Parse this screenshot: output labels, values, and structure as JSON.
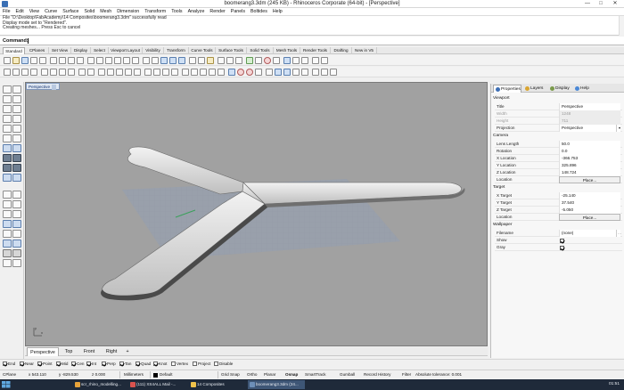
{
  "window": {
    "title": "boomerang3.3dm (245 KB) - Rhinoceros Corporate (64-bit) - [Perspective]",
    "minimize_glyph": "—",
    "maximize_glyph": "□",
    "close_glyph": "✕"
  },
  "menu": [
    "File",
    "Edit",
    "View",
    "Curve",
    "Surface",
    "Solid",
    "Mesh",
    "Dimension",
    "Transform",
    "Tools",
    "Analyze",
    "Render",
    "Panels",
    "Boltides",
    "Help"
  ],
  "history": [
    "File \"D:\\Desktop\\FabAcademy\\14 Composites\\boomerang3.3dm\" successfully read",
    "Display mode set to \"Rendered\".",
    "Creating meshes... Press Esc to cancel"
  ],
  "command": {
    "label": "Command:"
  },
  "toolbar_tabs": [
    "Standard",
    "CPlanes",
    "Set View",
    "Display",
    "Select",
    "Viewport Layout",
    "Visibility",
    "Transform",
    "Curve Tools",
    "Surface Tools",
    "Solid Tools",
    "Mesh Tools",
    "Render Tools",
    "Drafting",
    "New in V5"
  ],
  "viewport": {
    "name": "Perspective",
    "axis_x": "x",
    "axis_y": "y"
  },
  "viewport_tabs": [
    "Perspective",
    "Top",
    "Front",
    "Right",
    "+"
  ],
  "osnaps": [
    {
      "label": "End",
      "on": true
    },
    {
      "label": "Near",
      "on": true
    },
    {
      "label": "Point",
      "on": true
    },
    {
      "label": "Mid",
      "on": true
    },
    {
      "label": "Cen",
      "on": true
    },
    {
      "label": "Int",
      "on": true
    },
    {
      "label": "Perp",
      "on": true
    },
    {
      "label": "Tan",
      "on": true
    },
    {
      "label": "Quad",
      "on": true
    },
    {
      "label": "Knot",
      "on": true
    },
    {
      "label": "Vertex",
      "on": false
    },
    {
      "label": "Project",
      "on": false
    },
    {
      "label": "Disable",
      "on": false
    }
  ],
  "status": {
    "cplane": "CPlane",
    "x": "x 543.110",
    "y": "y -829.530",
    "z": "z 0.000",
    "units": "Millimeters",
    "layer": "Default",
    "layer_color": "#000000",
    "toggles": [
      "Grid Snap",
      "Ortho",
      "Planar",
      "Osnap",
      "SmartTrack",
      "Gumball",
      "Record History",
      "Filter"
    ],
    "tolerance": "Absolute tolerance: 0.001"
  },
  "panel": {
    "tabs": [
      "Properties",
      "Layers",
      "Display",
      "Help"
    ],
    "viewport_section": "Viewport",
    "viewport_rows": [
      {
        "k": "Title",
        "v": "Perspective",
        "dim": false
      },
      {
        "k": "Width",
        "v": "1248",
        "dim": true
      },
      {
        "k": "Height",
        "v": "711",
        "dim": true
      },
      {
        "k": "Projection",
        "v": "Perspective",
        "dim": false,
        "dropdown": true
      }
    ],
    "camera_section": "Camera",
    "camera_rows": [
      {
        "k": "Lens Length",
        "v": "50.0"
      },
      {
        "k": "Rotation",
        "v": "0.0"
      },
      {
        "k": "X Location",
        "v": "-366.753"
      },
      {
        "k": "Y Location",
        "v": "325.896"
      },
      {
        "k": "Z Location",
        "v": "148.724"
      },
      {
        "k": "Location",
        "v": "Place...",
        "button": true
      }
    ],
    "target_section": "Target",
    "target_rows": [
      {
        "k": "X Target",
        "v": "-25.140"
      },
      {
        "k": "Y Target",
        "v": "37.540"
      },
      {
        "k": "Z Target",
        "v": "-5.050"
      },
      {
        "k": "Location",
        "v": "Place...",
        "button": true
      }
    ],
    "wallpaper_section": "Wallpaper",
    "wallpaper_rows": [
      {
        "k": "Filename",
        "v": "(none)"
      },
      {
        "k": "Show",
        "check": true
      },
      {
        "k": "Gray",
        "check": true
      }
    ]
  },
  "taskbar": {
    "items": [
      {
        "label": "scr_rhino_modelling...",
        "color": "#e8a33a"
      },
      {
        "label": "(111) XS4ALL Mail -...",
        "color": "#d9534f"
      },
      {
        "label": "14 Composites",
        "color": "#f0c24b"
      },
      {
        "label": "boomerang3.3dm (24...",
        "color": "#6d8fb8",
        "active": true
      }
    ],
    "clock": "01:51"
  }
}
